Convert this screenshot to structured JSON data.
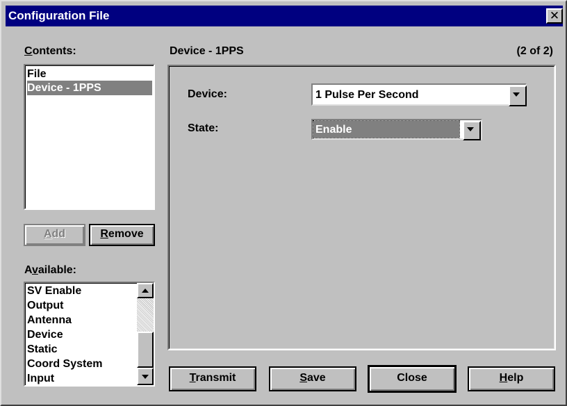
{
  "window": {
    "title": "Configuration File",
    "close_glyph": "✕"
  },
  "contents": {
    "label_accel": "C",
    "label_rest": "ontents:",
    "items": [
      "File",
      "Device - 1PPS"
    ],
    "selected_index": 1
  },
  "buttons": {
    "add_accel": "A",
    "add_rest": "dd",
    "remove_accel": "R",
    "remove_rest": "emove",
    "transmit_accel": "T",
    "transmit_rest": "ransmit",
    "save_accel": "S",
    "save_rest": "ave",
    "close": "Close",
    "help_accel": "H",
    "help_rest": "elp"
  },
  "available": {
    "label_pre": "A",
    "label_accel": "v",
    "label_rest": "ailable:",
    "items": [
      "SV Enable",
      "Output",
      "Antenna",
      "Device",
      "Static",
      "Coord System",
      "Input"
    ]
  },
  "panel": {
    "heading": "Device - 1PPS",
    "counter": "(2 of 2)",
    "device_label": "Device:",
    "device_value": "1 Pulse Per Second",
    "state_label": "State:",
    "state_value": "Enable"
  },
  "colors": {
    "titlebar": "#000080",
    "face": "#c0c0c0",
    "selection": "#808080"
  }
}
